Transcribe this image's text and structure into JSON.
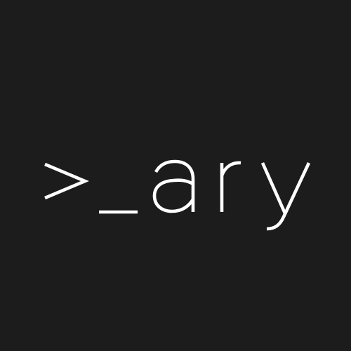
{
  "logo": {
    "text": ">_ary",
    "foreground_color": "#ffffff",
    "background_color": "#1c1c1c"
  }
}
